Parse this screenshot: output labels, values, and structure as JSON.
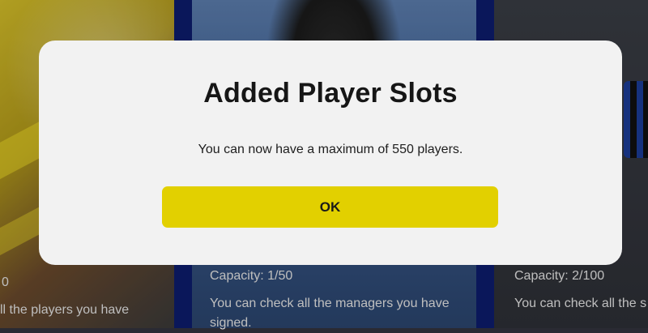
{
  "dialog": {
    "title": "Added Player Slots",
    "message": "You can now have a maximum of 550 players.",
    "ok_label": "OK"
  },
  "background_cards": {
    "left": {
      "capacity_partial": "0",
      "description_partial": "ll the players you have"
    },
    "middle": {
      "capacity": "Capacity: 1/50",
      "description": "You can check all the managers you have signed."
    },
    "right": {
      "capacity": "Capacity: 2/100",
      "description_partial": "You can check all the s"
    }
  },
  "colors": {
    "dialog_bg": "#f2f2f2",
    "ok_button": "#e2d000"
  }
}
